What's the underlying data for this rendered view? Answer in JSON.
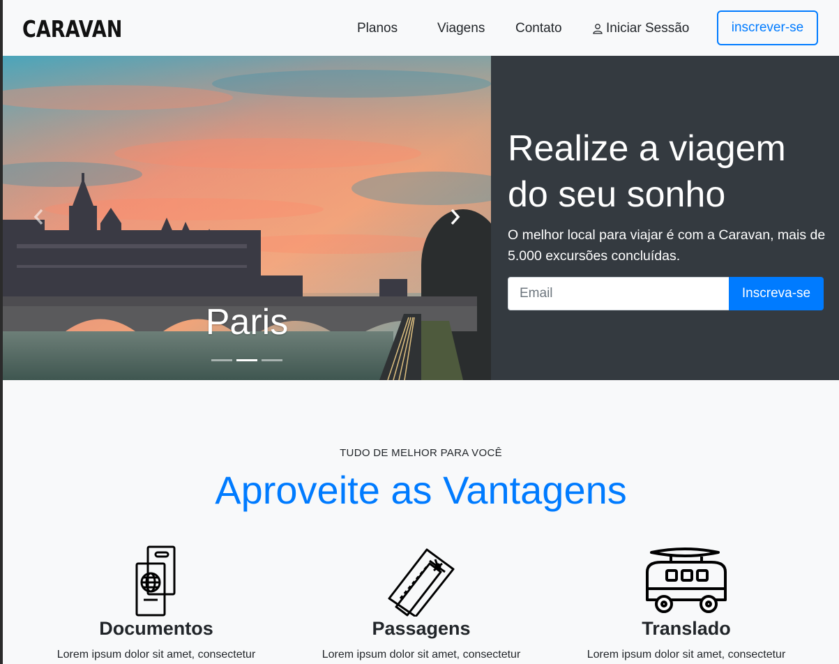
{
  "brand": {
    "name": "CARAVAN"
  },
  "nav": {
    "planos": "Planos",
    "viagens": "Viagens",
    "contato": "Contato",
    "login": "Iniciar Sessão",
    "signup": "inscrever-se"
  },
  "carousel": {
    "caption": "Paris",
    "slide_count": 3,
    "active_slide": 2
  },
  "hero": {
    "title": "Realize a viagem do seu sonho",
    "subtitle": "O melhor local para viajar é com a Caravan, mais de 5.000 excursões concluídas.",
    "email_placeholder": "Email",
    "cta": "Inscreva-se"
  },
  "features": {
    "eyebrow": "TUDO DE MELHOR PARA VOCÊ",
    "title": "Aproveite as Vantagens",
    "items": [
      {
        "title": "Documentos",
        "text": "Lorem ipsum dolor sit amet, consectetur",
        "icon": "passport-icon"
      },
      {
        "title": "Passagens",
        "text": "Lorem ipsum dolor sit amet, consectetur",
        "icon": "plane-ticket-icon"
      },
      {
        "title": "Translado",
        "text": "Lorem ipsum dolor sit amet, consectetur",
        "icon": "van-icon"
      }
    ]
  },
  "colors": {
    "primary": "#007bff",
    "dark_panel": "#343a40",
    "background": "#f8f9fa"
  }
}
